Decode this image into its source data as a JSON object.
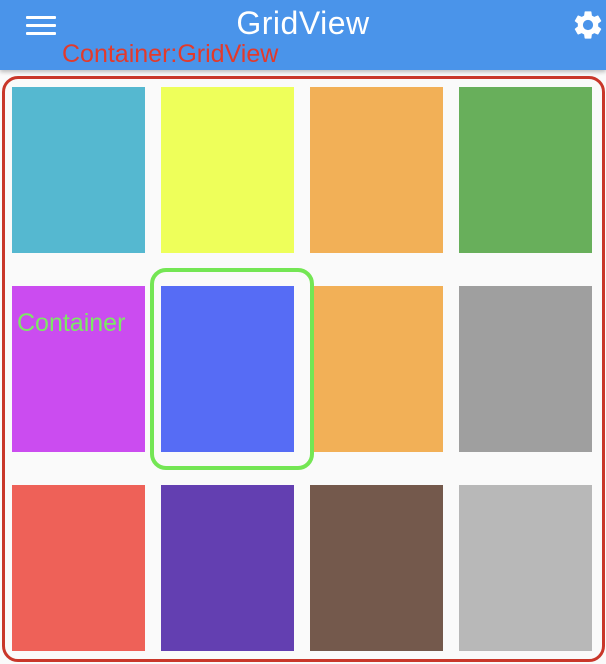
{
  "appbar": {
    "title": "GridView",
    "color": "#4a94ea",
    "menu_icon": "hamburger-menu-icon",
    "settings_icon": "gear-icon"
  },
  "annotations": {
    "grid_label": "Container:GridView",
    "grid_label_color": "#e23a2c",
    "tile_label": "Container",
    "tile_label_color": "#7ce865"
  },
  "grid": {
    "columns": 4,
    "rows": 3,
    "tiles": [
      {
        "color": "#55b8d0"
      },
      {
        "color": "#eeff5a"
      },
      {
        "color": "#f2b057"
      },
      {
        "color": "#68af5b"
      },
      {
        "color": "#cb4cf0"
      },
      {
        "color": "#566cf5"
      },
      {
        "color": "#f2b057"
      },
      {
        "color": "#9f9f9f"
      },
      {
        "color": "#ee6158"
      },
      {
        "color": "#633fb1"
      },
      {
        "color": "#74594c"
      },
      {
        "color": "#b8b8b8"
      }
    ],
    "highlighted_tile_index": 5
  }
}
